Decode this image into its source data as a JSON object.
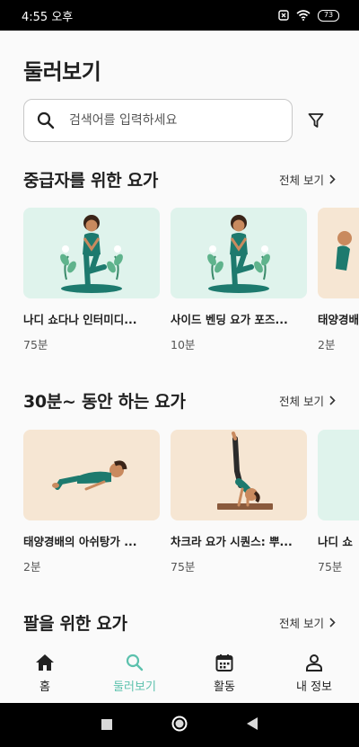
{
  "status_bar": {
    "time": "4:55 오후",
    "battery": "73"
  },
  "page": {
    "title": "둘러보기"
  },
  "search": {
    "placeholder": "검색어를 입력하세요"
  },
  "sections": [
    {
      "title": "중급자를 위한 요가",
      "see_all": "전체 보기",
      "cards": [
        {
          "title": "나디 쇼다나 인터미디...",
          "duration": "75분",
          "bg": "#dff3ec"
        },
        {
          "title": "사이드 벤딩 요가 포즈...",
          "duration": "10분",
          "bg": "#dff3ec"
        },
        {
          "title": "태양경배",
          "duration": "2분",
          "bg": "#f6e6d3"
        }
      ]
    },
    {
      "title": "30분~ 동안 하는 요가",
      "see_all": "전체 보기",
      "cards": [
        {
          "title": "태양경배의 아쉬탕가 ...",
          "duration": "2분",
          "bg": "#f6e6d3"
        },
        {
          "title": "차크라 요가 시퀀스: 뿌...",
          "duration": "75분",
          "bg": "#f6e6d3"
        },
        {
          "title": "나디 쇼",
          "duration": "75분",
          "bg": "#dff3ec"
        }
      ]
    },
    {
      "title": "팔을 위한 요가",
      "see_all": "전체 보기"
    }
  ],
  "nav": [
    {
      "label": "홈",
      "icon": "home-icon"
    },
    {
      "label": "둘러보기",
      "icon": "search-icon",
      "active": true
    },
    {
      "label": "활동",
      "icon": "calendar-icon"
    },
    {
      "label": "내 정보",
      "icon": "person-icon"
    }
  ],
  "colors": {
    "accent": "#5cc1ad",
    "mint": "#dff3ec",
    "peach": "#f6e6d3",
    "teal": "#1d7a6e"
  }
}
